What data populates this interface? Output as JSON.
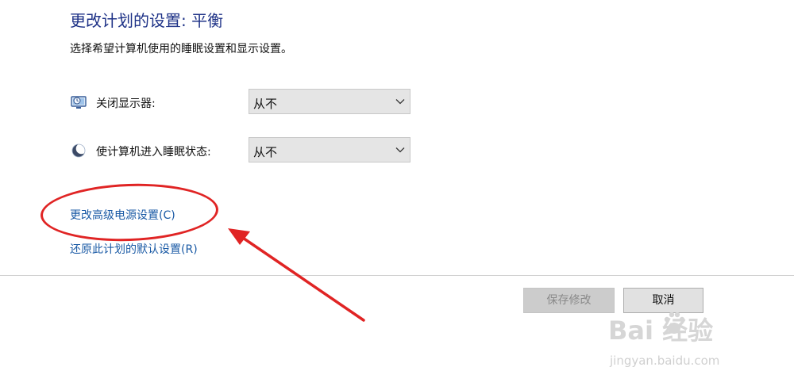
{
  "header": {
    "title": "更改计划的设置: 平衡",
    "description": "选择希望计算机使用的睡眠设置和显示设置。"
  },
  "settings": [
    {
      "icon": "monitor-icon",
      "label": "关闭显示器:",
      "value": "从不"
    },
    {
      "icon": "moon-icon",
      "label": "使计算机进入睡眠状态:",
      "value": "从不"
    }
  ],
  "links": {
    "advanced": "更改高级电源设置(C)",
    "restore": "还原此计划的默认设置(R)"
  },
  "buttons": {
    "save": "保存修改",
    "cancel": "取消"
  },
  "watermark": {
    "logo": "Bai 经验",
    "url": "jingyan.baidu.com"
  },
  "colors": {
    "title": "#1e3287",
    "link": "#1a5aa5",
    "annotation": "#e02424"
  }
}
